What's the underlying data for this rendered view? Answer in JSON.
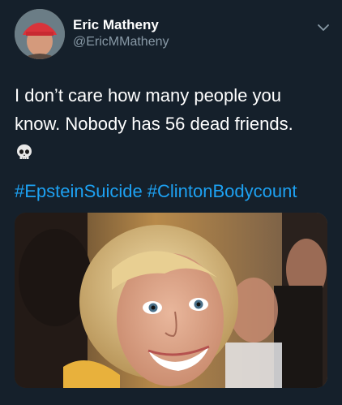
{
  "user": {
    "display_name": "Eric Matheny",
    "handle": "@EricMMatheny"
  },
  "tweet": {
    "line1": "I don’t care how many people you",
    "line2": "know. Nobody has 56 dead friends.",
    "emoji": "skull-emoji",
    "hashtags": [
      "#EpsteinSuicide",
      "#ClintonBodycount"
    ]
  },
  "icons": {
    "menu": "chevron-down-icon",
    "emoji": "skull-icon"
  },
  "colors": {
    "background": "#15202b",
    "text": "#ffffff",
    "secondary": "#8899a6",
    "link": "#1da1f2"
  }
}
